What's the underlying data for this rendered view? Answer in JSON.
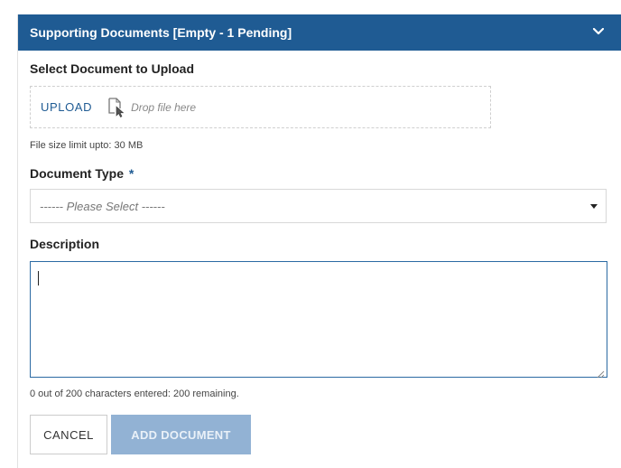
{
  "panel": {
    "title": "Supporting Documents [Empty - 1 Pending]"
  },
  "upload": {
    "section_label": "Select Document to Upload",
    "upload_label": "UPLOAD",
    "drop_text": "Drop file here",
    "size_limit": "File size limit upto: 30 MB"
  },
  "document_type": {
    "label": "Document Type",
    "required_marker": "*",
    "selected_value": "------ Please Select ------"
  },
  "description": {
    "label": "Description",
    "value": "",
    "char_counter": "0 out of 200 characters entered: 200 remaining."
  },
  "actions": {
    "cancel_label": "CANCEL",
    "add_label": "ADD DOCUMENT"
  },
  "colors": {
    "header_bg": "#1f5b93",
    "link": "#1f5b93",
    "disabled_button": "#92b2d4"
  },
  "icons": {
    "header_toggle": "chevron-down-icon",
    "drop": "file-drop-cursor-icon",
    "select_caret": "caret-down-icon",
    "textarea_resize": "resize-grip-icon"
  }
}
